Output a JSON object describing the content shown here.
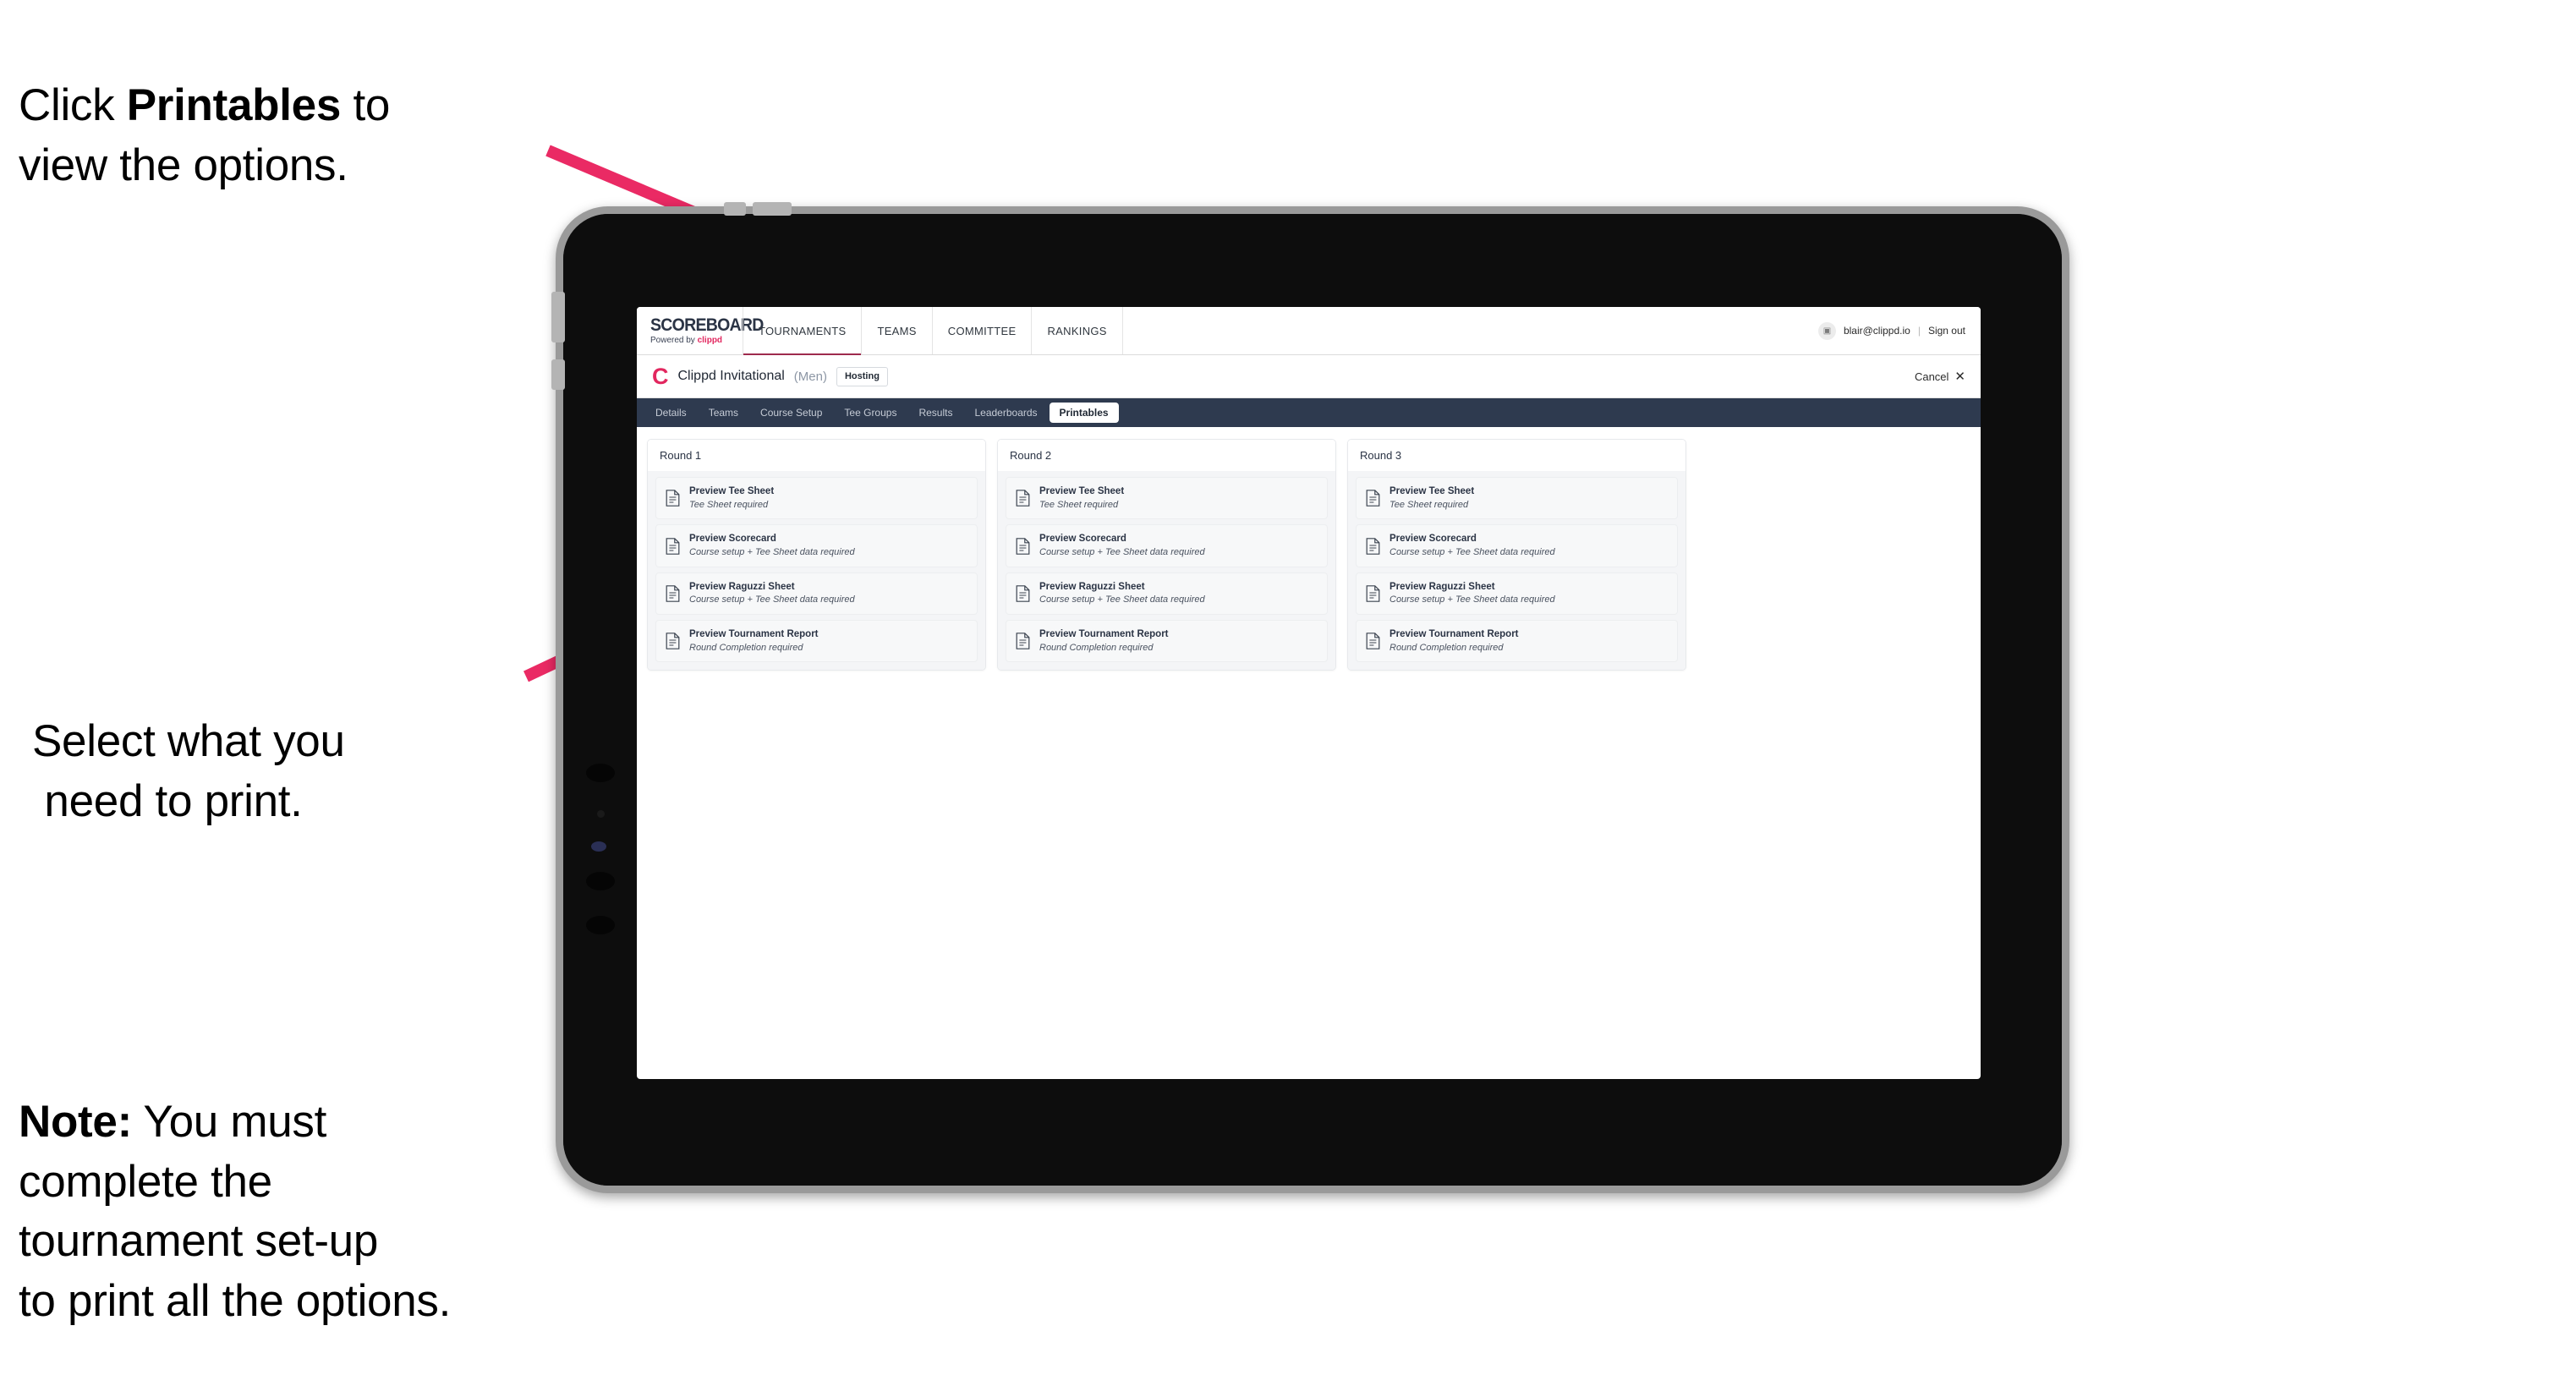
{
  "annotations": [
    {
      "id": "a1",
      "text": "Click Printables to\nview the options.",
      "bold_word": "Printables"
    },
    {
      "id": "a2",
      "text": "Select what you\n need to print."
    },
    {
      "id": "a3",
      "text": "Note: You must\ncomplete the\ntournament set-up\nto print all the options.",
      "bold_word": "Note:"
    }
  ],
  "annotation_color": "#000000",
  "arrow_color": "#ea2a64",
  "app": {
    "brand": {
      "title": "SCOREBOARD",
      "powered_prefix": "Powered by ",
      "powered_brand": "clippd",
      "brand_color": "#e2275f"
    },
    "top_nav": [
      {
        "label": "TOURNAMENTS",
        "active": true
      },
      {
        "label": "TEAMS",
        "active": false
      },
      {
        "label": "COMMITTEE",
        "active": false
      },
      {
        "label": "RANKINGS",
        "active": false
      }
    ],
    "account": {
      "avatar_glyph": "▣",
      "email": "blair@clippd.io",
      "separator": "|",
      "sign_out": "Sign out"
    },
    "tournament": {
      "logo_letter": "C",
      "name": "Clippd Invitational",
      "gender": "(Men)",
      "badge": "Hosting",
      "cancel_label": "Cancel",
      "cancel_icon": "✕"
    },
    "tabs": [
      {
        "label": "Details",
        "active": false
      },
      {
        "label": "Teams",
        "active": false
      },
      {
        "label": "Course Setup",
        "active": false
      },
      {
        "label": "Tee Groups",
        "active": false
      },
      {
        "label": "Results",
        "active": false
      },
      {
        "label": "Leaderboards",
        "active": false
      },
      {
        "label": "Printables",
        "active": true
      }
    ],
    "rounds": [
      {
        "title": "Round 1",
        "items": [
          {
            "title": "Preview Tee Sheet",
            "subtitle": "Tee Sheet required"
          },
          {
            "title": "Preview Scorecard",
            "subtitle": "Course setup + Tee Sheet data required"
          },
          {
            "title": "Preview Raguzzi Sheet",
            "subtitle": "Course setup + Tee Sheet data required"
          },
          {
            "title": "Preview Tournament Report",
            "subtitle": "Round Completion required"
          }
        ]
      },
      {
        "title": "Round 2",
        "items": [
          {
            "title": "Preview Tee Sheet",
            "subtitle": "Tee Sheet required"
          },
          {
            "title": "Preview Scorecard",
            "subtitle": "Course setup + Tee Sheet data required"
          },
          {
            "title": "Preview Raguzzi Sheet",
            "subtitle": "Course setup + Tee Sheet data required"
          },
          {
            "title": "Preview Tournament Report",
            "subtitle": "Round Completion required"
          }
        ]
      },
      {
        "title": "Round 3",
        "items": [
          {
            "title": "Preview Tee Sheet",
            "subtitle": "Tee Sheet required"
          },
          {
            "title": "Preview Scorecard",
            "subtitle": "Course setup + Tee Sheet data required"
          },
          {
            "title": "Preview Raguzzi Sheet",
            "subtitle": "Course setup + Tee Sheet data required"
          },
          {
            "title": "Preview Tournament Report",
            "subtitle": "Round Completion required"
          }
        ]
      }
    ]
  }
}
